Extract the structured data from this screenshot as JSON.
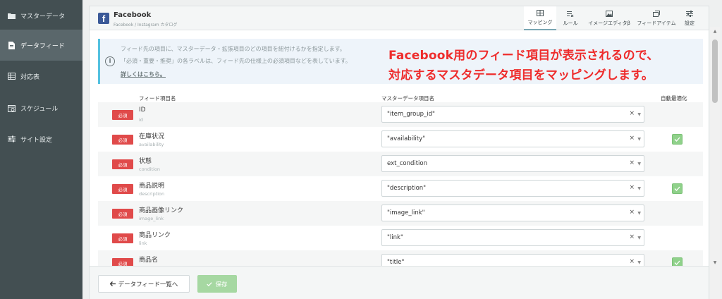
{
  "sidebar": {
    "items": [
      {
        "label": "マスターデータ",
        "icon": "folder-icon"
      },
      {
        "label": "データフィード",
        "icon": "file-icon"
      },
      {
        "label": "対応表",
        "icon": "table-icon"
      },
      {
        "label": "スケジュール",
        "icon": "calendar-icon"
      },
      {
        "label": "サイト設定",
        "icon": "sliders-icon"
      }
    ],
    "active_index": 1
  },
  "header": {
    "logo_letter": "f",
    "title": "Facebook",
    "subtitle": "Facebook / Instagram カタログ",
    "tabs": [
      {
        "label": "マッピング",
        "icon": "mapping-icon",
        "active": true
      },
      {
        "label": "ルール",
        "icon": "rules-icon"
      },
      {
        "label": "イメージエディタβ",
        "icon": "image-editor-icon"
      },
      {
        "label": "フィードアイテム",
        "icon": "feed-item-icon"
      },
      {
        "label": "設定",
        "icon": "settings-icon"
      }
    ]
  },
  "info": {
    "icon": "i",
    "line1": "フィード先の項目に、マスターデータ・拡張項目のどの項目を紐付けるかを指定します。",
    "line2": "「必須・重要・推奨」の各ラベルは、フィード先の仕様上の必須項目などを表しています。",
    "link": "詳しくはこちら。"
  },
  "annotation": {
    "line1": "Facebook用のフィード項目が表示されるので、",
    "line2": "対応するマスタデータ項目をマッピングします。"
  },
  "table": {
    "headers": {
      "feed_field": "フィード項目名",
      "master_field": "マスターデータ項目名",
      "auto_optimize": "自動最適化"
    },
    "rows": [
      {
        "badge": "必須",
        "name": "ID",
        "key": "id",
        "value": "\"item_group_id\"",
        "auto": false
      },
      {
        "badge": "必須",
        "name": "在庫状況",
        "key": "availability",
        "value": "\"availability\"",
        "auto": true
      },
      {
        "badge": "必須",
        "name": "状態",
        "key": "condition",
        "value": "ext_condition",
        "auto": false
      },
      {
        "badge": "必須",
        "name": "商品説明",
        "key": "description",
        "value": "\"description\"",
        "auto": true
      },
      {
        "badge": "必須",
        "name": "商品画像リンク",
        "key": "image_link",
        "value": "\"image_link\"",
        "auto": false
      },
      {
        "badge": "必須",
        "name": "商品リンク",
        "key": "link",
        "value": "\"link\"",
        "auto": false
      },
      {
        "badge": "必須",
        "name": "商品名",
        "key": "title",
        "value": "\"title\"",
        "auto": true
      }
    ],
    "clear_symbol": "×",
    "caret_symbol": "▼",
    "check_symbol": "✓"
  },
  "footer": {
    "back_label": "データフィード一覧へ",
    "save_label": "保存"
  },
  "colors": {
    "sidebar": "#434f52",
    "required": "#e04a4a",
    "annotation": "#ee2c2c",
    "check": "#8fd18a",
    "save": "#a6d8a2",
    "info_border": "#53c1e0"
  }
}
